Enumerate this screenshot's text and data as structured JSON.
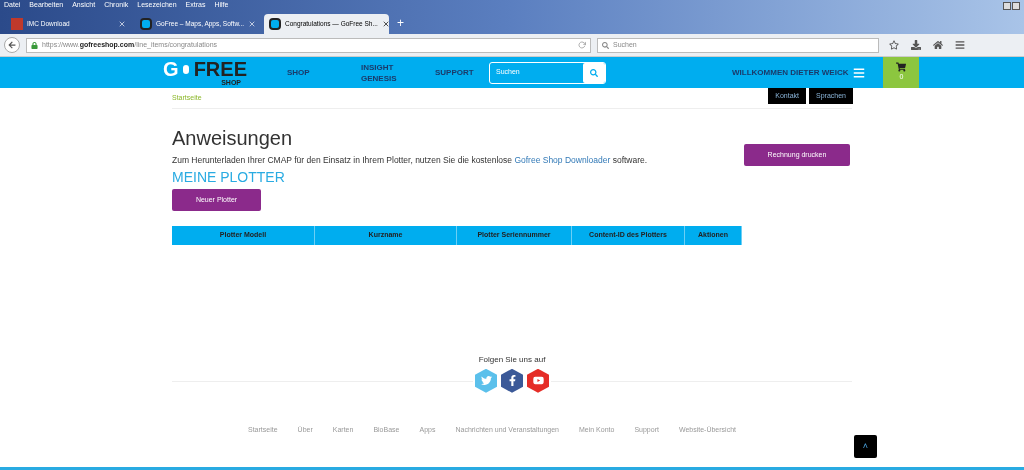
{
  "menu_bar": [
    "Datei",
    "Bearbeiten",
    "Ansicht",
    "Chronik",
    "Lesezeichen",
    "Extras",
    "Hilfe"
  ],
  "tabs": [
    {
      "label": "IMC Download",
      "selected": false,
      "kind": "imc"
    },
    {
      "label": "GoFree – Maps, Apps, Softw...",
      "selected": false,
      "kind": "gofree"
    },
    {
      "label": "Congratulations — GoFree Sh...",
      "selected": true,
      "kind": "gofree"
    }
  ],
  "new_tab": "+",
  "address_bar": {
    "prefix": "https://www.",
    "domain": "gofreeshop.com",
    "path": "/line_items/congratulations"
  },
  "browser_search": {
    "placeholder": "Suchen"
  },
  "site_header": {
    "logo": {
      "left": "G",
      "right": "FREE",
      "sub": "SHOP"
    },
    "nav": [
      "SHOP",
      "INSIGHT GENESIS",
      "SUPPORT"
    ],
    "search": {
      "placeholder": "Suchen"
    },
    "welcome": "WILLKOMMEN DIETER WEICK",
    "cart_count": "0"
  },
  "breadcrumb": "Startseite",
  "top_links": [
    "Kontakt",
    "Sprachen"
  ],
  "heading": "Anweisungen",
  "instructions": {
    "before": "Zum Herunterladen Ihrer CMAP für den Einsatz in Ihrem Plotter, nutzen Sie die kostenlose ",
    "link": "Gofree Shop Downloader",
    "after": " software."
  },
  "print_button": "Rechnung drucken",
  "section_title": "MEINE PLOTTER",
  "new_button": "Neuer Plotter",
  "table": {
    "columns": [
      "Plotter Modell",
      "Kurzname",
      "Plotter Seriennummer",
      "Content-ID des Plotters",
      "Aktionen"
    ]
  },
  "follow_text": "Folgen Sie uns auf",
  "social": [
    {
      "kind": "twitter",
      "color": "#5bc0eb"
    },
    {
      "kind": "facebook",
      "color": "#3b5998"
    },
    {
      "kind": "youtube",
      "color": "#e52d27"
    }
  ],
  "footer_links": [
    "Startseite",
    "Über",
    "Karten",
    "BioBase",
    "Apps",
    "Nachrichten und Veranstaltungen",
    "Mein Konto",
    "Support",
    "Website-Übersicht"
  ],
  "back_to_top": "˄"
}
